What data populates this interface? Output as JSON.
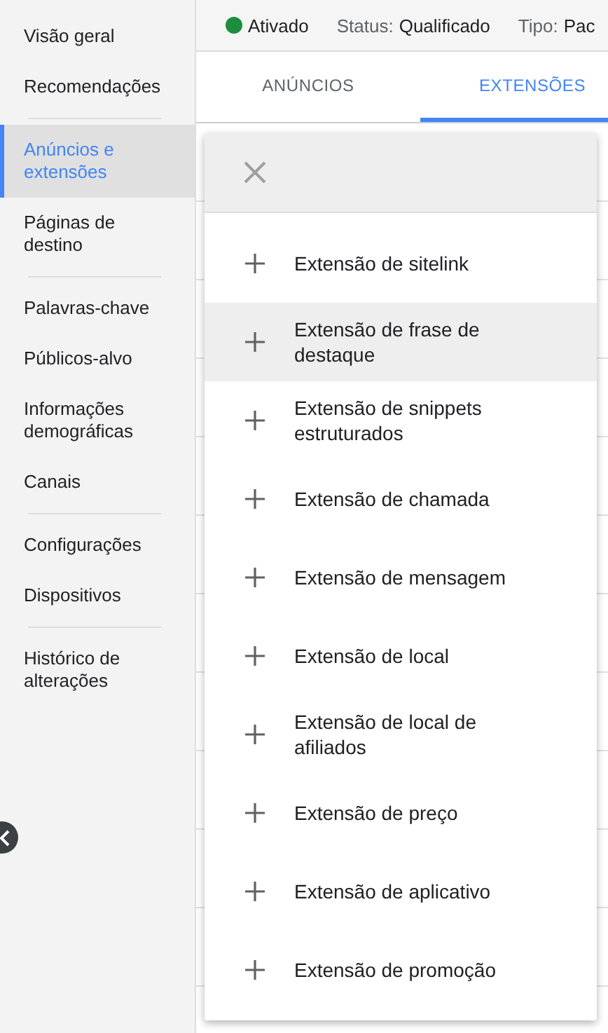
{
  "sidebar": {
    "groups": [
      {
        "items": [
          {
            "label": "Visão geral",
            "selected": false
          },
          {
            "label": "Recomendações",
            "selected": false
          }
        ]
      },
      {
        "items": [
          {
            "label": "Anúncios e extensões",
            "selected": true
          },
          {
            "label": "Páginas de destino",
            "selected": false
          }
        ]
      },
      {
        "items": [
          {
            "label": "Palavras-chave",
            "selected": false
          },
          {
            "label": "Públicos-alvo",
            "selected": false
          },
          {
            "label": "Informações demográficas",
            "selected": false
          },
          {
            "label": "Canais",
            "selected": false
          }
        ]
      },
      {
        "items": [
          {
            "label": "Configurações",
            "selected": false
          },
          {
            "label": "Dispositivos",
            "selected": false
          }
        ]
      },
      {
        "items": [
          {
            "label": "Histórico de alterações",
            "selected": false
          }
        ]
      }
    ]
  },
  "status_bar": {
    "state": {
      "label": "Ativado",
      "color": "#1e8e3e"
    },
    "fields": [
      {
        "label": "Status:",
        "value": "Qualificado"
      },
      {
        "label": "Tipo:",
        "value": "Pac"
      }
    ]
  },
  "tabs": [
    {
      "label": "ANÚNCIOS",
      "selected": false
    },
    {
      "label": "EXTENSÕES",
      "selected": true
    }
  ],
  "extension_menu": {
    "items": [
      {
        "label": "Extensão de sitelink",
        "hovered": false
      },
      {
        "label": "Extensão de frase de destaque",
        "hovered": true
      },
      {
        "label": "Extensão de snippets estruturados",
        "hovered": false
      },
      {
        "label": "Extensão de chamada",
        "hovered": false
      },
      {
        "label": "Extensão de mensagem",
        "hovered": false
      },
      {
        "label": "Extensão de local",
        "hovered": false
      },
      {
        "label": "Extensão de local de afiliados",
        "hovered": false
      },
      {
        "label": "Extensão de preço",
        "hovered": false
      },
      {
        "label": "Extensão de aplicativo",
        "hovered": false
      },
      {
        "label": "Extensão de promoção",
        "hovered": false
      }
    ]
  }
}
